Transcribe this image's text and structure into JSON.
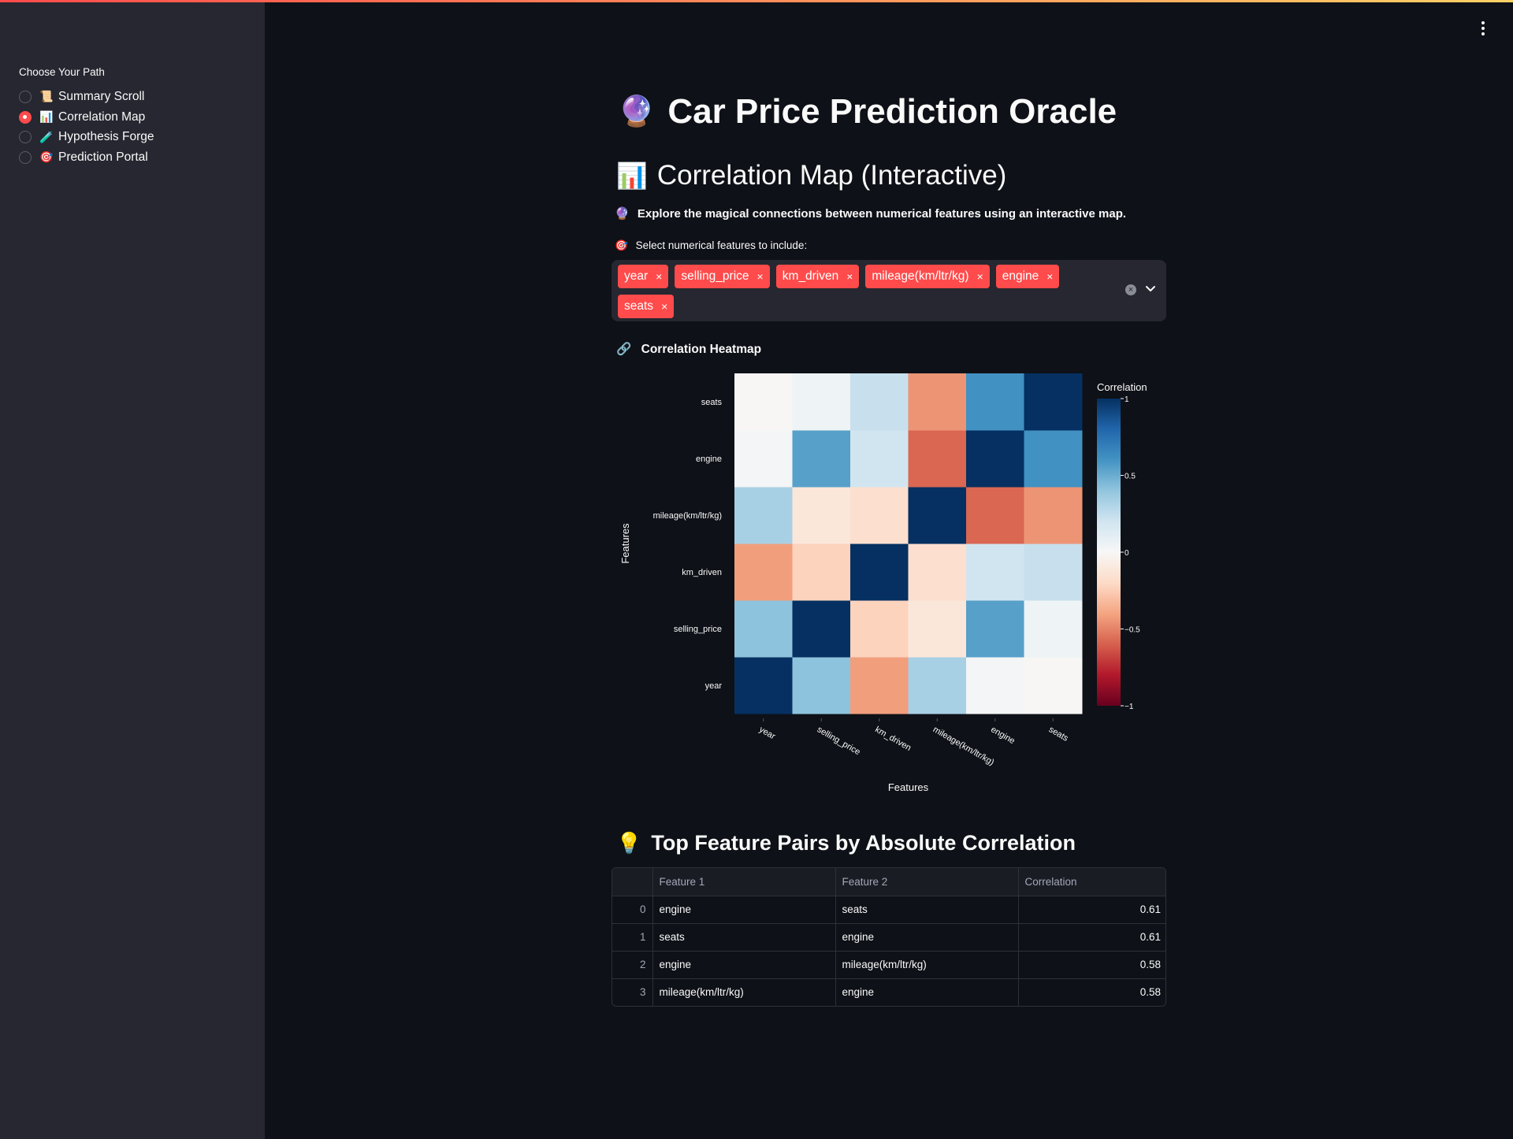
{
  "sidebar": {
    "label": "Choose Your Path",
    "items": [
      {
        "emoji": "📜",
        "label": "Summary Scroll",
        "selected": false
      },
      {
        "emoji": "📊",
        "label": "Correlation Map",
        "selected": true
      },
      {
        "emoji": "🧪",
        "label": "Hypothesis Forge",
        "selected": false
      },
      {
        "emoji": "🎯",
        "label": "Prediction Portal",
        "selected": false
      }
    ]
  },
  "main": {
    "title_emoji": "🔮",
    "title": "Car Price Prediction Oracle",
    "section_emoji": "📊",
    "section_title": "Correlation Map (Interactive)",
    "description_emoji": "🔮",
    "description": "Explore the magical connections between numerical features using an interactive map.",
    "select_emoji": "🎯",
    "select_label": "Select numerical features to include:",
    "selected_features": [
      "year",
      "selling_price",
      "km_driven",
      "mileage(km/ltr/kg)",
      "engine",
      "seats"
    ],
    "tag_remove_glyph": "×",
    "clear_glyph": "×",
    "heatmap_emoji": "🔗",
    "heatmap_title": "Correlation Heatmap",
    "pairs_emoji": "💡",
    "pairs_title": "Top Feature Pairs by Absolute Correlation"
  },
  "table": {
    "columns": [
      "",
      "Feature 1",
      "Feature 2",
      "Correlation"
    ],
    "rows": [
      [
        "0",
        "engine",
        "seats",
        "0.61"
      ],
      [
        "1",
        "seats",
        "engine",
        "0.61"
      ],
      [
        "2",
        "engine",
        "mileage(km/ltr/kg)",
        "0.58"
      ],
      [
        "3",
        "mileage(km/ltr/kg)",
        "engine",
        "0.58"
      ]
    ]
  },
  "colors": {
    "accent": "#ff4b4b",
    "background": "#0e1117",
    "sidebar": "#262730"
  },
  "chart_data": {
    "type": "heatmap",
    "xlabel": "Features",
    "ylabel": "Features",
    "x": [
      "year",
      "selling_price",
      "km_driven",
      "mileage(km/ltr/kg)",
      "engine",
      "seats"
    ],
    "y": [
      "year",
      "selling_price",
      "km_driven",
      "mileage(km/ltr/kg)",
      "engine",
      "seats"
    ],
    "z": [
      [
        1.0,
        0.41,
        -0.42,
        0.33,
        0.02,
        -0.01
      ],
      [
        0.41,
        1.0,
        -0.23,
        -0.12,
        0.55,
        0.05
      ],
      [
        -0.42,
        -0.23,
        1.0,
        -0.17,
        0.2,
        0.23
      ],
      [
        0.33,
        -0.12,
        -0.17,
        1.0,
        -0.58,
        -0.45
      ],
      [
        0.02,
        0.55,
        0.2,
        -0.58,
        1.0,
        0.61
      ],
      [
        -0.01,
        0.05,
        0.23,
        -0.45,
        0.61,
        1.0
      ]
    ],
    "colorscale": "RdBu",
    "zrange": [
      -1,
      1
    ],
    "colorbar_title": "Correlation",
    "colorbar_ticks": [
      "1",
      "0.5",
      "0",
      "−0.5",
      "−1"
    ],
    "colorbar_tick_values": [
      1,
      0.5,
      0,
      -0.5,
      -1
    ]
  }
}
